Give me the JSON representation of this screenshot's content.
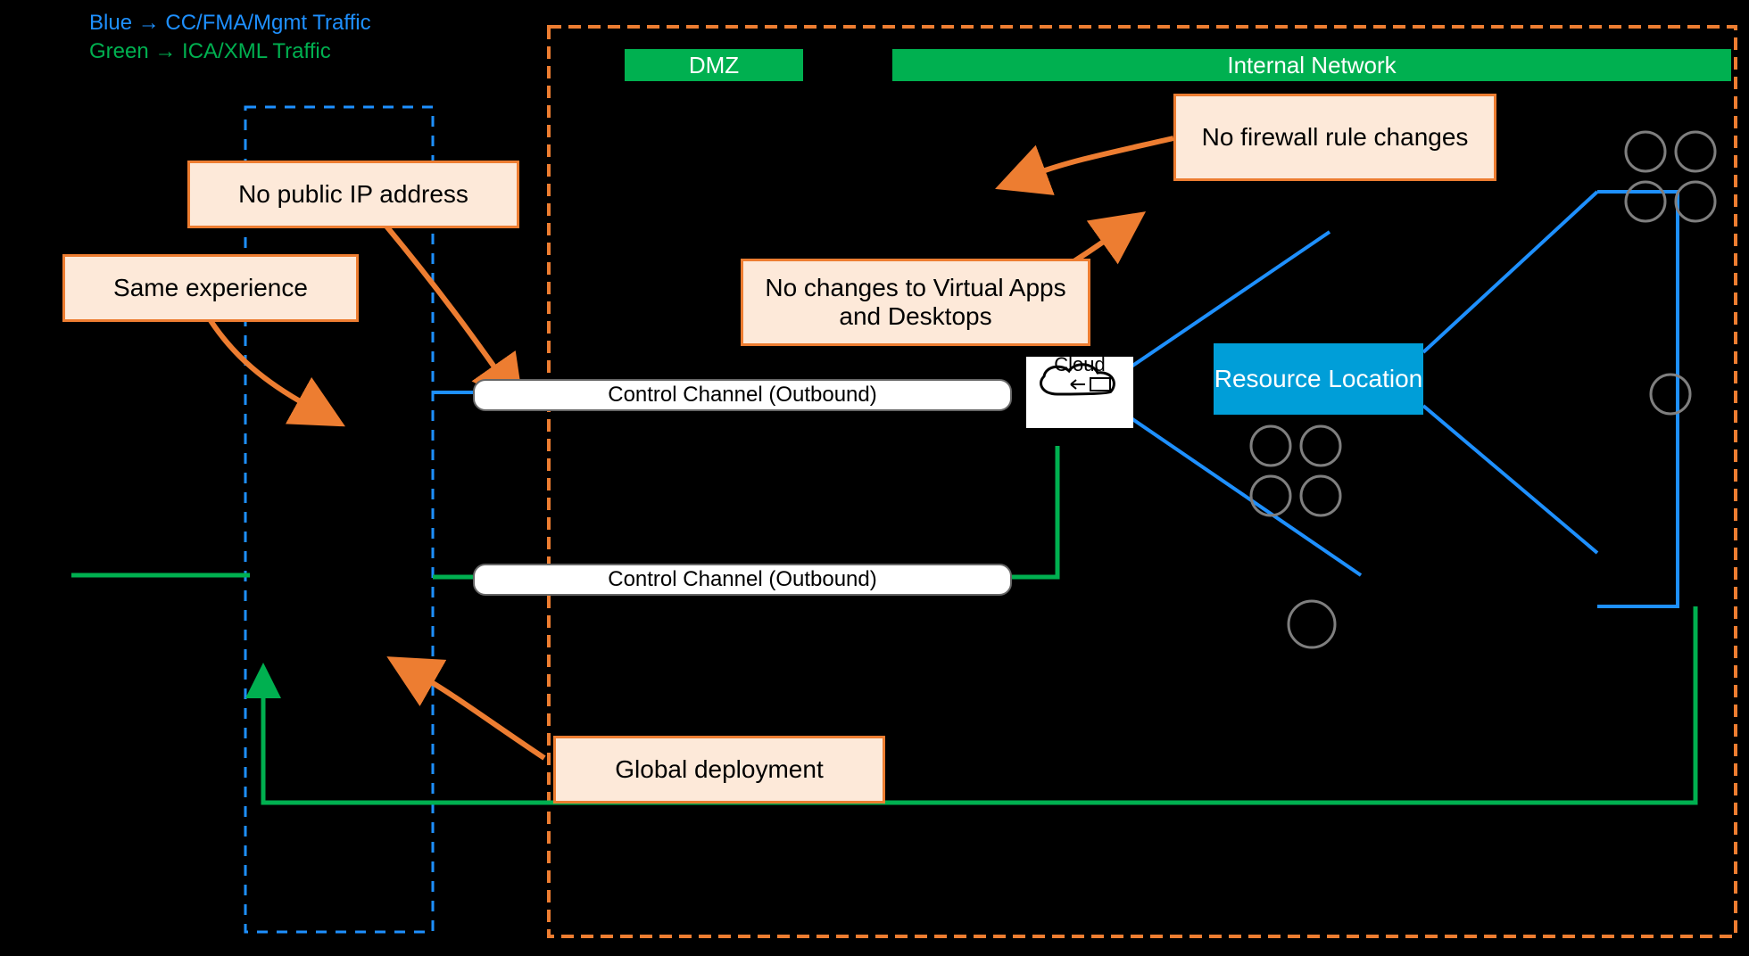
{
  "legend": {
    "blue": "Blue   →  CC/FMA/Mgmt Traffic",
    "green": "Green →  ICA/XML Traffic"
  },
  "zones": {
    "dmz": "DMZ",
    "internal": "Internal Network"
  },
  "callouts": {
    "same": "Same experience",
    "nopub": "No public IP address",
    "nofw": "No firewall rule changes",
    "nochg": "No changes to Virtual Apps and Desktops",
    "global": "Global deployment"
  },
  "channels": {
    "c1": "Control Channel (Outbound)",
    "c2": "Control Channel (Outbound)"
  },
  "cloud": "Cloud",
  "resource": "Resource Location"
}
